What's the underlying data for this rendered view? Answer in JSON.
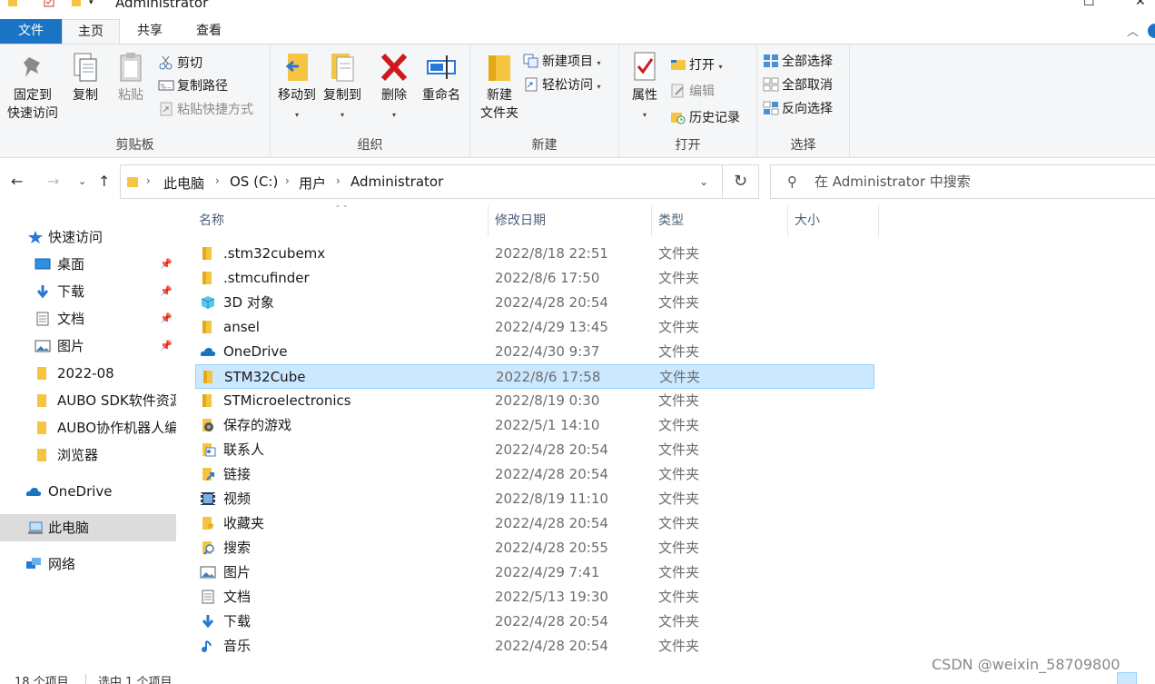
{
  "window": {
    "title": "Administrator"
  },
  "tabs": [
    {
      "label": "文件"
    },
    {
      "label": "主页"
    },
    {
      "label": "共享"
    },
    {
      "label": "查看"
    }
  ],
  "ribbon": {
    "clipboard": {
      "label": "剪贴板",
      "pin_line1": "固定到",
      "pin_line2": "快速访问",
      "copy": "复制",
      "paste": "粘贴",
      "cut": "剪切",
      "copy_path": "复制路径",
      "paste_shortcut": "粘贴快捷方式"
    },
    "organize": {
      "label": "组织",
      "move_to": "移动到",
      "copy_to": "复制到",
      "delete": "删除",
      "rename": "重命名"
    },
    "new": {
      "label": "新建",
      "new_folder_line1": "新建",
      "new_folder_line2": "文件夹",
      "new_item": "新建项目",
      "easy_access": "轻松访问"
    },
    "open": {
      "label": "打开",
      "properties": "属性",
      "open": "打开",
      "edit": "编辑",
      "history": "历史记录"
    },
    "select": {
      "label": "选择",
      "select_all": "全部选择",
      "select_none": "全部取消",
      "invert": "反向选择"
    }
  },
  "address": {
    "segments": [
      "此电脑",
      "OS (C:)",
      "用户",
      "Administrator"
    ]
  },
  "search": {
    "placeholder": "在 Administrator 中搜索"
  },
  "nav": [
    {
      "label": "快速访问",
      "icon": "star-icon"
    },
    {
      "label": "桌面",
      "icon": "desktop-icon"
    },
    {
      "label": "下载",
      "icon": "download-icon"
    },
    {
      "label": "文档",
      "icon": "document-icon"
    },
    {
      "label": "图片",
      "icon": "picture-icon"
    },
    {
      "label": "2022-08",
      "icon": "folder-icon"
    },
    {
      "label": "AUBO SDK软件资源",
      "icon": "folder-icon"
    },
    {
      "label": "AUBO协作机器人编",
      "icon": "folder-icon"
    },
    {
      "label": "浏览器",
      "icon": "folder-icon"
    },
    {
      "label": "OneDrive",
      "icon": "cloud-icon"
    },
    {
      "label": "此电脑",
      "icon": "computer-icon"
    },
    {
      "label": "网络",
      "icon": "network-icon"
    }
  ],
  "columns": {
    "name": "名称",
    "date": "修改日期",
    "type": "类型",
    "size": "大小"
  },
  "files": [
    {
      "name": ".stm32cubemx",
      "date": "2022/8/18 22:51",
      "type": "文件夹",
      "icon": "folder-icon"
    },
    {
      "name": ".stmcufinder",
      "date": "2022/8/6 17:50",
      "type": "文件夹",
      "icon": "folder-icon"
    },
    {
      "name": "3D 对象",
      "date": "2022/4/28 20:54",
      "type": "文件夹",
      "icon": "3d-objects-icon"
    },
    {
      "name": "ansel",
      "date": "2022/4/29 13:45",
      "type": "文件夹",
      "icon": "folder-icon"
    },
    {
      "name": "OneDrive",
      "date": "2022/4/30 9:37",
      "type": "文件夹",
      "icon": "cloud-icon"
    },
    {
      "name": "STM32Cube",
      "date": "2022/8/6 17:58",
      "type": "文件夹",
      "icon": "folder-icon"
    },
    {
      "name": "STMicroelectronics",
      "date": "2022/8/19 0:30",
      "type": "文件夹",
      "icon": "folder-icon"
    },
    {
      "name": "保存的游戏",
      "date": "2022/5/1 14:10",
      "type": "文件夹",
      "icon": "saved-games-icon"
    },
    {
      "name": "联系人",
      "date": "2022/4/28 20:54",
      "type": "文件夹",
      "icon": "contacts-icon"
    },
    {
      "name": "链接",
      "date": "2022/4/28 20:54",
      "type": "文件夹",
      "icon": "links-icon"
    },
    {
      "name": "视频",
      "date": "2022/8/19 11:10",
      "type": "文件夹",
      "icon": "video-icon"
    },
    {
      "name": "收藏夹",
      "date": "2022/4/28 20:54",
      "type": "文件夹",
      "icon": "favorites-icon"
    },
    {
      "name": "搜索",
      "date": "2022/4/28 20:55",
      "type": "文件夹",
      "icon": "searches-icon"
    },
    {
      "name": "图片",
      "date": "2022/4/29 7:41",
      "type": "文件夹",
      "icon": "picture-icon"
    },
    {
      "name": "文档",
      "date": "2022/5/13 19:30",
      "type": "文件夹",
      "icon": "document-icon"
    },
    {
      "name": "下载",
      "date": "2022/4/28 20:54",
      "type": "文件夹",
      "icon": "download-icon"
    },
    {
      "name": "音乐",
      "date": "2022/4/28 20:54",
      "type": "文件夹",
      "icon": "music-icon"
    }
  ],
  "status": {
    "count": "18 个项目",
    "selected": "选中 1 个项目"
  },
  "watermark": "CSDN @weixin_58709800",
  "colors": {
    "accent": "#1a73c5",
    "selected_bg": "#cce8ff",
    "folder": "#f5c542"
  }
}
